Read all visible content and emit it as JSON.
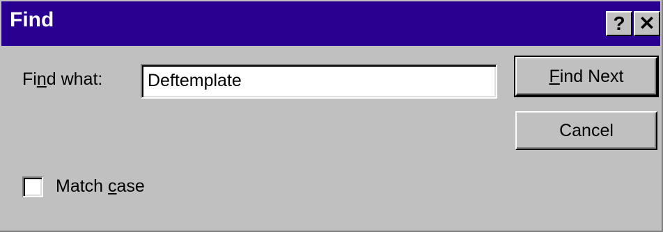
{
  "window": {
    "title": "Find",
    "help_button": "?",
    "close_button": "✕"
  },
  "find": {
    "label_pre": "Fi",
    "label_mnemonic": "n",
    "label_post": "d what:",
    "value": "Deftemplate"
  },
  "buttons": {
    "find_next_mnemonic": "F",
    "find_next_rest": "ind Next",
    "cancel": "Cancel"
  },
  "match_case": {
    "label_pre": "Match ",
    "label_mnemonic": "c",
    "label_post": "ase",
    "checked": false
  },
  "colors": {
    "title_bar": "#2a0090",
    "face": "#c0c0c0"
  }
}
